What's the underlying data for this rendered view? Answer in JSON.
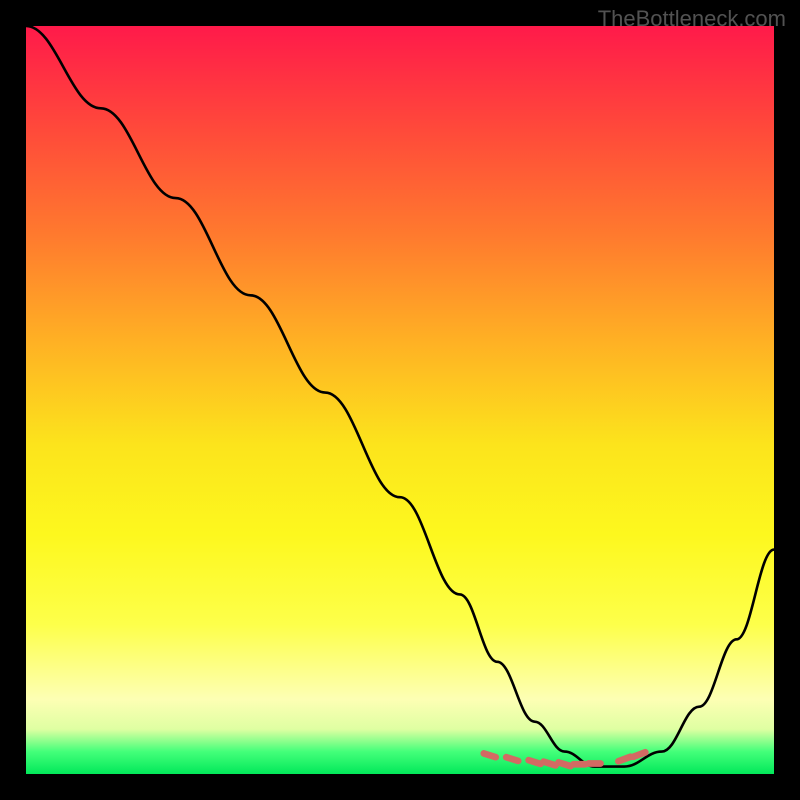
{
  "watermark": "TheBottleneck.com",
  "chart_data": {
    "type": "line",
    "title": "",
    "xlabel": "",
    "ylabel": "",
    "xlim": [
      0,
      100
    ],
    "ylim": [
      0,
      100
    ],
    "series": [
      {
        "name": "bottleneck-curve",
        "x": [
          0,
          10,
          20,
          30,
          40,
          50,
          58,
          63,
          68,
          72,
          76,
          80,
          85,
          90,
          95,
          100
        ],
        "values": [
          100,
          89,
          77,
          64,
          51,
          37,
          24,
          15,
          7,
          3,
          1,
          1,
          3,
          9,
          18,
          30
        ]
      }
    ],
    "markers": {
      "name": "highlight-dashes",
      "color": "#d36a63",
      "x": [
        62,
        65,
        68,
        70,
        72,
        74,
        76,
        80,
        82
      ],
      "y": [
        2.5,
        2.0,
        1.6,
        1.4,
        1.3,
        1.3,
        1.4,
        2.0,
        2.6
      ]
    }
  }
}
